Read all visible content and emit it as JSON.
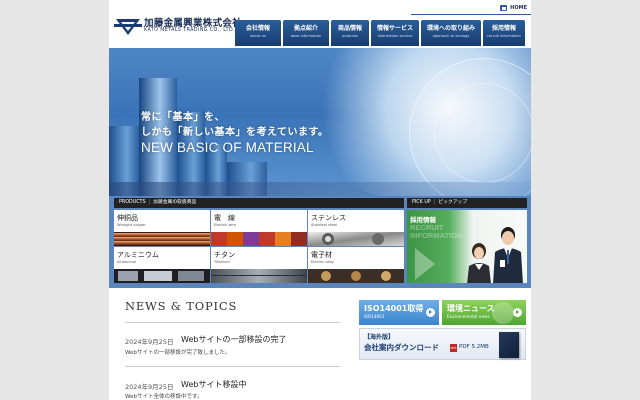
{
  "header": {
    "logo_jp": "加藤金属興業株式会社",
    "logo_en": "KATO METALS TRADING CO., LTD.",
    "home_label": "HOME"
  },
  "nav": [
    {
      "jp": "会社情報",
      "en": "about us"
    },
    {
      "jp": "拠点紹介",
      "en": "base information"
    },
    {
      "jp": "商品情報",
      "en": "products"
    },
    {
      "jp": "情報サービス",
      "en": "information service"
    },
    {
      "jp": "環境への取り組み",
      "en": "approach to ecology"
    },
    {
      "jp": "採用情報",
      "en": "recruit information"
    }
  ],
  "hero": {
    "line1": "常に「基本」を、",
    "line2": "しかも「新しい基本」を考えています。",
    "line_en": "NEW BASIC OF MATERIAL"
  },
  "products": {
    "head_en": "PRODUCTS",
    "head_jp": "加藤金属の取扱商品",
    "items": [
      {
        "jp": "伸銅品",
        "en": "Wrought copper"
      },
      {
        "jp": "電　線",
        "en": "Electric wire"
      },
      {
        "jp": "ステンレス",
        "en": "Stainless steel"
      },
      {
        "jp": "アルミニウム",
        "en": "Aluminium"
      },
      {
        "jp": "チタン",
        "en": "Titanium"
      },
      {
        "jp": "電子材",
        "en": "Electric alloy"
      }
    ]
  },
  "pickup": {
    "head_en": "PICK UP",
    "head_jp": "ピックアップ",
    "recruit_jp": "採用情報",
    "recruit_en": "RECRUIT INFORMATION"
  },
  "news": {
    "title": "NEWS & TOPICS",
    "items": [
      {
        "date": "2024年9月25日",
        "headline": "Webサイトの一部移設の完了",
        "body": "Webサイトの一部移設が完了致しました。"
      },
      {
        "date": "2024年9月25日",
        "headline": "Webサイト移設中",
        "body": "Webサイト全体の移設中です。"
      }
    ]
  },
  "banners": {
    "iso_jp": "ISO14001取得",
    "iso_en": "ISO14001",
    "eco_jp": "環境ニュース",
    "eco_en": "Environmental news",
    "brochure_l1": "【海外版】",
    "brochure_l2": "会社案内ダウンロード",
    "pdf_label": "PDF",
    "pdf_size": "PDF 5.2MB"
  },
  "colors": {
    "nav_blue": "#1f4b85",
    "products_band": "#5a86bb",
    "recruit_green": "#3c9445"
  }
}
